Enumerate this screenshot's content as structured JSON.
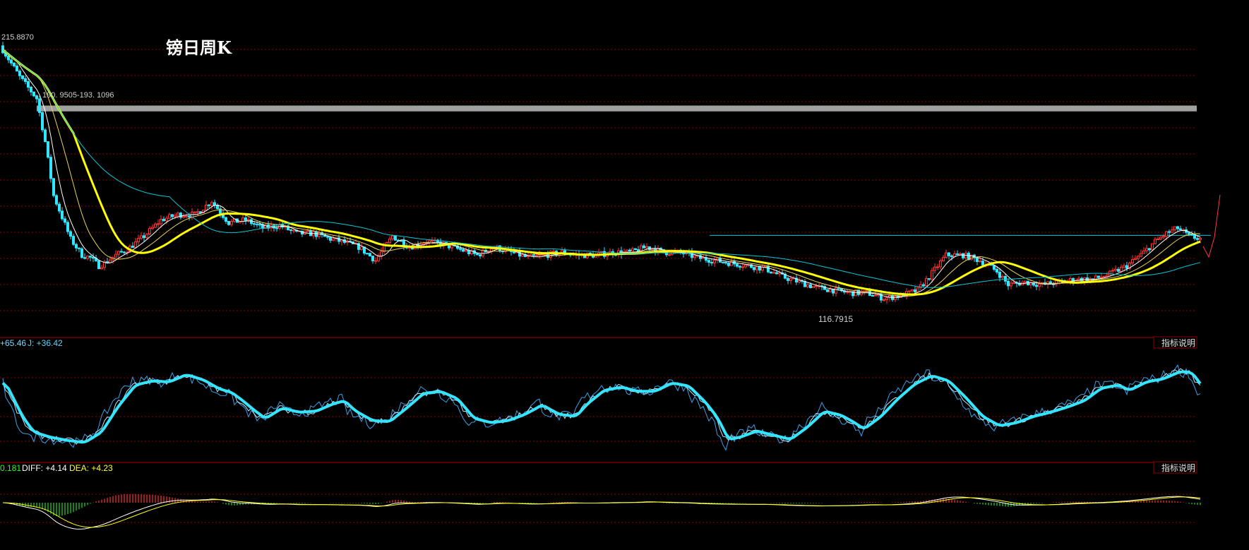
{
  "title": "镑日周K",
  "price_panel": {
    "high_label": "215.8870",
    "low_label": "116.7915",
    "band_label": "190. 9505-193. 1096",
    "band": [
      190.9505,
      193.1096
    ],
    "y_range": [
      108,
      222
    ],
    "colors": {
      "up": "#ff3333",
      "down": "#33e6ff",
      "ma_thick": "#ffff00",
      "ma_white": "#ffffff",
      "ma_yellow": "#e8d25a",
      "ma_cyan": "#00c8d8",
      "band": "#a0a0a0",
      "grid": "#8a0000"
    }
  },
  "kdj_panel": {
    "header_prefix": "+65.46",
    "header_j": "J: +36.42",
    "explain_button": "指标说明",
    "y_range": [
      0,
      100
    ]
  },
  "macd_panel": {
    "header_prefix": "0.181",
    "header_diff": "DIFF: +4.14",
    "header_dea": "DEA: +4.23",
    "explain_button": "指标说明",
    "colors": {
      "hist_up": "#ff3333",
      "hist_down": "#22dd22",
      "diff": "#ffffff",
      "dea": "#ffff00"
    }
  },
  "chart_data": {
    "type": "candlestick",
    "x": "weekly bars (no dates printed)",
    "price_anchors": [
      [
        0,
        214
      ],
      [
        6,
        204
      ],
      [
        12,
        196
      ],
      [
        15,
        180
      ],
      [
        18,
        160
      ],
      [
        21,
        152
      ],
      [
        24,
        144
      ],
      [
        28,
        138
      ],
      [
        31,
        137
      ],
      [
        34,
        134
      ],
      [
        36,
        135
      ],
      [
        40,
        138
      ],
      [
        44,
        140
      ],
      [
        50,
        145
      ],
      [
        56,
        151
      ],
      [
        62,
        153
      ],
      [
        68,
        153
      ],
      [
        74,
        158
      ],
      [
        80,
        150
      ],
      [
        86,
        151
      ],
      [
        92,
        148
      ],
      [
        98,
        149
      ],
      [
        104,
        146
      ],
      [
        110,
        146
      ],
      [
        116,
        144
      ],
      [
        120,
        143
      ],
      [
        126,
        141
      ],
      [
        132,
        136
      ],
      [
        138,
        145
      ],
      [
        144,
        141
      ],
      [
        150,
        143
      ],
      [
        156,
        142
      ],
      [
        162,
        140
      ],
      [
        168,
        138
      ],
      [
        174,
        141
      ],
      [
        180,
        139
      ],
      [
        186,
        137
      ],
      [
        192,
        138
      ],
      [
        198,
        139
      ],
      [
        204,
        138
      ],
      [
        210,
        138
      ],
      [
        216,
        139
      ],
      [
        222,
        139
      ],
      [
        228,
        141
      ],
      [
        234,
        139
      ],
      [
        240,
        139
      ],
      [
        246,
        137
      ],
      [
        252,
        136
      ],
      [
        258,
        135
      ],
      [
        264,
        134
      ],
      [
        270,
        133
      ],
      [
        276,
        130
      ],
      [
        282,
        128
      ],
      [
        288,
        126
      ],
      [
        294,
        125
      ],
      [
        300,
        124
      ],
      [
        306,
        124
      ],
      [
        312,
        122
      ],
      [
        318,
        123
      ],
      [
        324,
        125
      ],
      [
        328,
        130
      ],
      [
        334,
        138
      ],
      [
        340,
        138
      ],
      [
        346,
        136
      ],
      [
        352,
        132
      ],
      [
        356,
        127
      ],
      [
        362,
        128
      ],
      [
        368,
        127
      ],
      [
        374,
        128
      ],
      [
        380,
        129
      ],
      [
        386,
        129
      ],
      [
        392,
        131
      ],
      [
        398,
        134
      ],
      [
        404,
        139
      ],
      [
        408,
        143
      ],
      [
        412,
        146
      ],
      [
        416,
        148
      ],
      [
        420,
        145
      ],
      [
        424,
        144
      ]
    ],
    "kdj_anchors": [
      [
        0,
        72
      ],
      [
        6,
        40
      ],
      [
        10,
        25
      ],
      [
        16,
        20
      ],
      [
        22,
        17
      ],
      [
        28,
        15
      ],
      [
        34,
        25
      ],
      [
        40,
        50
      ],
      [
        46,
        70
      ],
      [
        52,
        74
      ],
      [
        58,
        73
      ],
      [
        64,
        80
      ],
      [
        70,
        75
      ],
      [
        76,
        66
      ],
      [
        80,
        63
      ],
      [
        84,
        55
      ],
      [
        88,
        46
      ],
      [
        92,
        38
      ],
      [
        98,
        48
      ],
      [
        104,
        44
      ],
      [
        110,
        45
      ],
      [
        116,
        52
      ],
      [
        120,
        55
      ],
      [
        124,
        45
      ],
      [
        130,
        36
      ],
      [
        136,
        35
      ],
      [
        142,
        48
      ],
      [
        148,
        62
      ],
      [
        154,
        64
      ],
      [
        160,
        57
      ],
      [
        166,
        38
      ],
      [
        172,
        34
      ],
      [
        178,
        36
      ],
      [
        184,
        42
      ],
      [
        190,
        51
      ],
      [
        196,
        42
      ],
      [
        202,
        40
      ],
      [
        206,
        52
      ],
      [
        212,
        65
      ],
      [
        218,
        68
      ],
      [
        224,
        64
      ],
      [
        230,
        64
      ],
      [
        236,
        72
      ],
      [
        242,
        69
      ],
      [
        248,
        53
      ],
      [
        252,
        39
      ],
      [
        256,
        18
      ],
      [
        260,
        20
      ],
      [
        266,
        26
      ],
      [
        272,
        22
      ],
      [
        278,
        18
      ],
      [
        284,
        30
      ],
      [
        290,
        45
      ],
      [
        296,
        41
      ],
      [
        300,
        35
      ],
      [
        304,
        28
      ],
      [
        310,
        40
      ],
      [
        316,
        57
      ],
      [
        322,
        71
      ],
      [
        328,
        79
      ],
      [
        334,
        74
      ],
      [
        340,
        58
      ],
      [
        346,
        40
      ],
      [
        352,
        31
      ],
      [
        358,
        34
      ],
      [
        364,
        40
      ],
      [
        370,
        44
      ],
      [
        376,
        49
      ],
      [
        382,
        55
      ],
      [
        388,
        67
      ],
      [
        394,
        70
      ],
      [
        398,
        65
      ],
      [
        404,
        73
      ],
      [
        410,
        76
      ],
      [
        416,
        83
      ],
      [
        420,
        82
      ],
      [
        424,
        68
      ]
    ]
  }
}
